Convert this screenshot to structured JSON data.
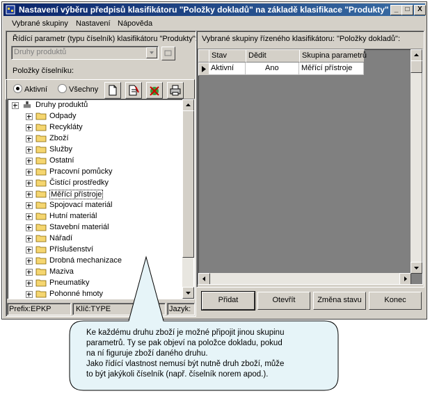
{
  "window": {
    "title": "Nastavení výběru předpisů klasifikátoru \"Položky dokladů\" na základě klasifikace \"Produkty\"",
    "controls": {
      "minimize": "_",
      "maximize": "□",
      "close": "X"
    }
  },
  "menu": {
    "items": [
      {
        "label": "Vybrané skupiny"
      },
      {
        "label": "Nastavení"
      },
      {
        "label": "Nápověda"
      }
    ]
  },
  "left": {
    "param_label": "Řídící parametr (typu číselník) klasifikátoru \"Produkty\":",
    "param_value": "Druhy produktů",
    "items_label": "Položky číselníku:",
    "filter": {
      "active": "Aktivní",
      "all": "Všechny",
      "selected": "active"
    },
    "tree": {
      "root": "Druhy produktů",
      "items": [
        "Odpady",
        "Recykláty",
        "Zboží",
        "Služby",
        "Ostatní",
        "Pracovní pomůcky",
        "Čistící prostředky",
        "Měřící přístroje",
        "Spojovací materiál",
        "Hutní materiál",
        "Stavební materiál",
        "Nářadí",
        "Příslušenství",
        "Drobná mechanizace",
        "Maziva",
        "Pneumatiky",
        "Pohonné hmoty"
      ],
      "selected_index": 7
    },
    "status": {
      "prefix": "Prefix:EPKP",
      "key": "Klíč:TYPE",
      "lang": "Jazyk:"
    }
  },
  "right": {
    "title": "Vybrané skupiny řízeného klasifikátoru: \"Položky dokladů\":",
    "columns": [
      "Stav",
      "Dědit",
      "Skupina parametrů"
    ],
    "rows": [
      {
        "stav": "Aktivní",
        "dedit": "Ano",
        "skupina": "Měřící přístroje"
      }
    ]
  },
  "buttons": {
    "add": "Přidat",
    "open": "Otevřít",
    "change": "Změna stavu",
    "end": "Konec"
  },
  "callout": {
    "lines": [
      "Ke každému druhu zboží je možné připojit jinou skupinu",
      "parametrů. Ty se pak objeví na položce dokladu, pokud",
      "na ní figuruje zboží daného druhu.",
      "Jako řídící vlastnost nemusí být nutně druh zboží, může",
      "to být jakýkoli číselník (např. číselník norem apod.)."
    ]
  },
  "colors": {
    "title_start": "#0a246a",
    "title_end": "#3a6ea5",
    "face": "#d4d0c8",
    "callout_fill": "#e6f4f8",
    "folder": "#f5d670"
  }
}
